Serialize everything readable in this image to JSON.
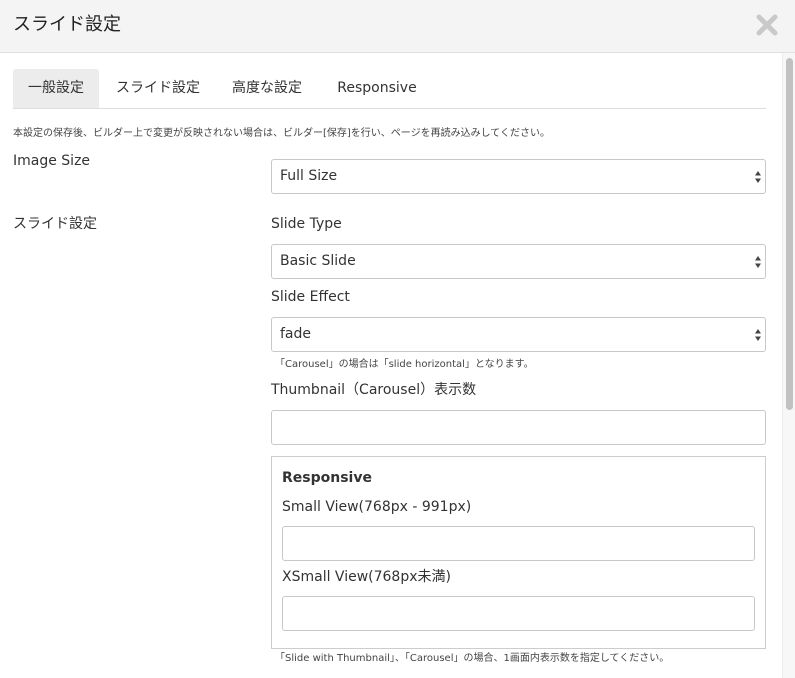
{
  "dialog": {
    "title": "スライド設定"
  },
  "tabs": [
    {
      "label": "一般設定",
      "active": true
    },
    {
      "label": "スライド設定",
      "active": false
    },
    {
      "label": "高度な設定",
      "active": false
    },
    {
      "label": "Responsive",
      "active": false
    }
  ],
  "notice": "本設定の保存後、ビルダー上で変更が反映されない場合は、ビルダー[保存]を行い、ページを再読み込みしてください。",
  "image_size": {
    "label": "Image Size",
    "value": "Full Size"
  },
  "slide_settings": {
    "label": "スライド設定",
    "slide_type": {
      "label": "Slide Type",
      "value": "Basic Slide"
    },
    "slide_effect": {
      "label": "Slide Effect",
      "value": "fade",
      "help": "「Carousel」の場合は「slide horizontal」となります。"
    },
    "thumbnail_count": {
      "label": "Thumbnail（Carousel）表示数",
      "value": ""
    },
    "responsive": {
      "heading": "Responsive",
      "small_view": {
        "label": "Small View(768px - 991px)",
        "value": ""
      },
      "xsmall_view": {
        "label": "XSmall View(768px未満)",
        "value": ""
      }
    },
    "footer_help": "「Slide with Thumbnail」、「Carousel」の場合、1画面内表示数を指定してください。"
  },
  "icons": {
    "close": "close-icon",
    "select_arrows": "select-arrows-icon"
  },
  "colors": {
    "titlebar_bg": "#f4f4f4",
    "active_tab_bg": "#ececec",
    "border": "#c8c8c8"
  }
}
